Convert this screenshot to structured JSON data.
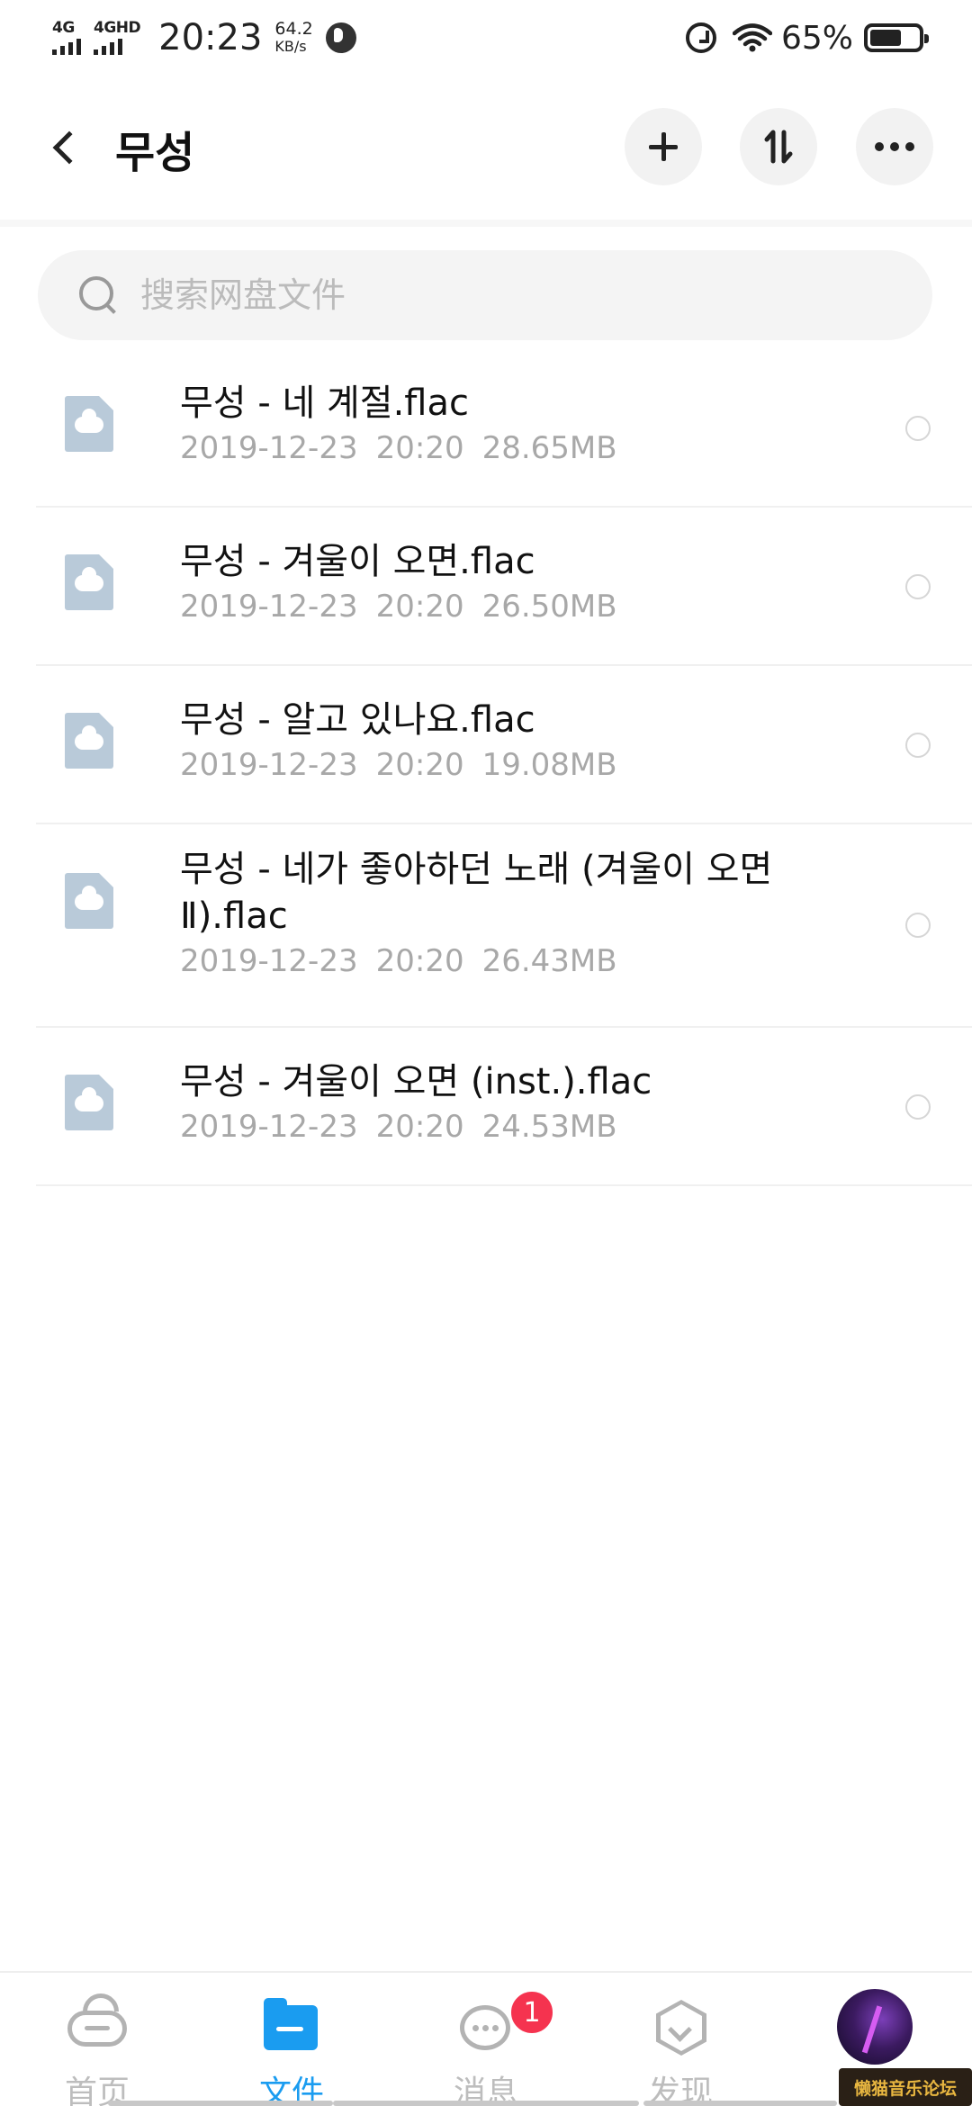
{
  "status_bar": {
    "network_1": "4G",
    "network_2": "4GHD",
    "time": "20:23",
    "speed_value": "64.2",
    "speed_unit": "KB/s",
    "battery_percent": "65%",
    "battery_level": 0.65,
    "icons": [
      "signal-icon",
      "globe-icon",
      "alarm-icon",
      "wifi-icon",
      "battery-icon"
    ]
  },
  "header": {
    "back_icon": "chevron-left-icon",
    "title": "무성",
    "actions": [
      "plus-icon",
      "sort-icon",
      "more-icon"
    ]
  },
  "search": {
    "placeholder": "搜索网盘文件",
    "value": ""
  },
  "files": [
    {
      "name": "무성 - 네 계절.flac",
      "date": "2019-12-23",
      "time": "20:20",
      "size": "28.65MB"
    },
    {
      "name": "무성 - 겨울이 오면.flac",
      "date": "2019-12-23",
      "time": "20:20",
      "size": "26.50MB"
    },
    {
      "name": "무성 - 알고 있나요.flac",
      "date": "2019-12-23",
      "time": "20:20",
      "size": "19.08MB"
    },
    {
      "name": "무성 - 네가 좋아하던 노래 (겨울이 오면 Ⅱ).flac",
      "date": "2019-12-23",
      "time": "20:20",
      "size": "26.43MB"
    },
    {
      "name": "무성 - 겨울이 오면 (inst.).flac",
      "date": "2019-12-23",
      "time": "20:20",
      "size": "24.53MB"
    }
  ],
  "bottom_nav": {
    "items": [
      {
        "label": "首页",
        "icon": "home-cloud-icon",
        "active": false
      },
      {
        "label": "文件",
        "icon": "folder-icon",
        "active": true
      },
      {
        "label": "消息",
        "icon": "message-icon",
        "active": false,
        "badge": "1"
      },
      {
        "label": "发现",
        "icon": "discover-icon",
        "active": false
      }
    ],
    "avatar": "avatar"
  },
  "watermark": "懒猫音乐论坛",
  "colors": {
    "accent": "#1a9cf0",
    "badge": "#f5334f",
    "file_icon": "#b9cad9",
    "meta_text": "#a8a8a8"
  }
}
